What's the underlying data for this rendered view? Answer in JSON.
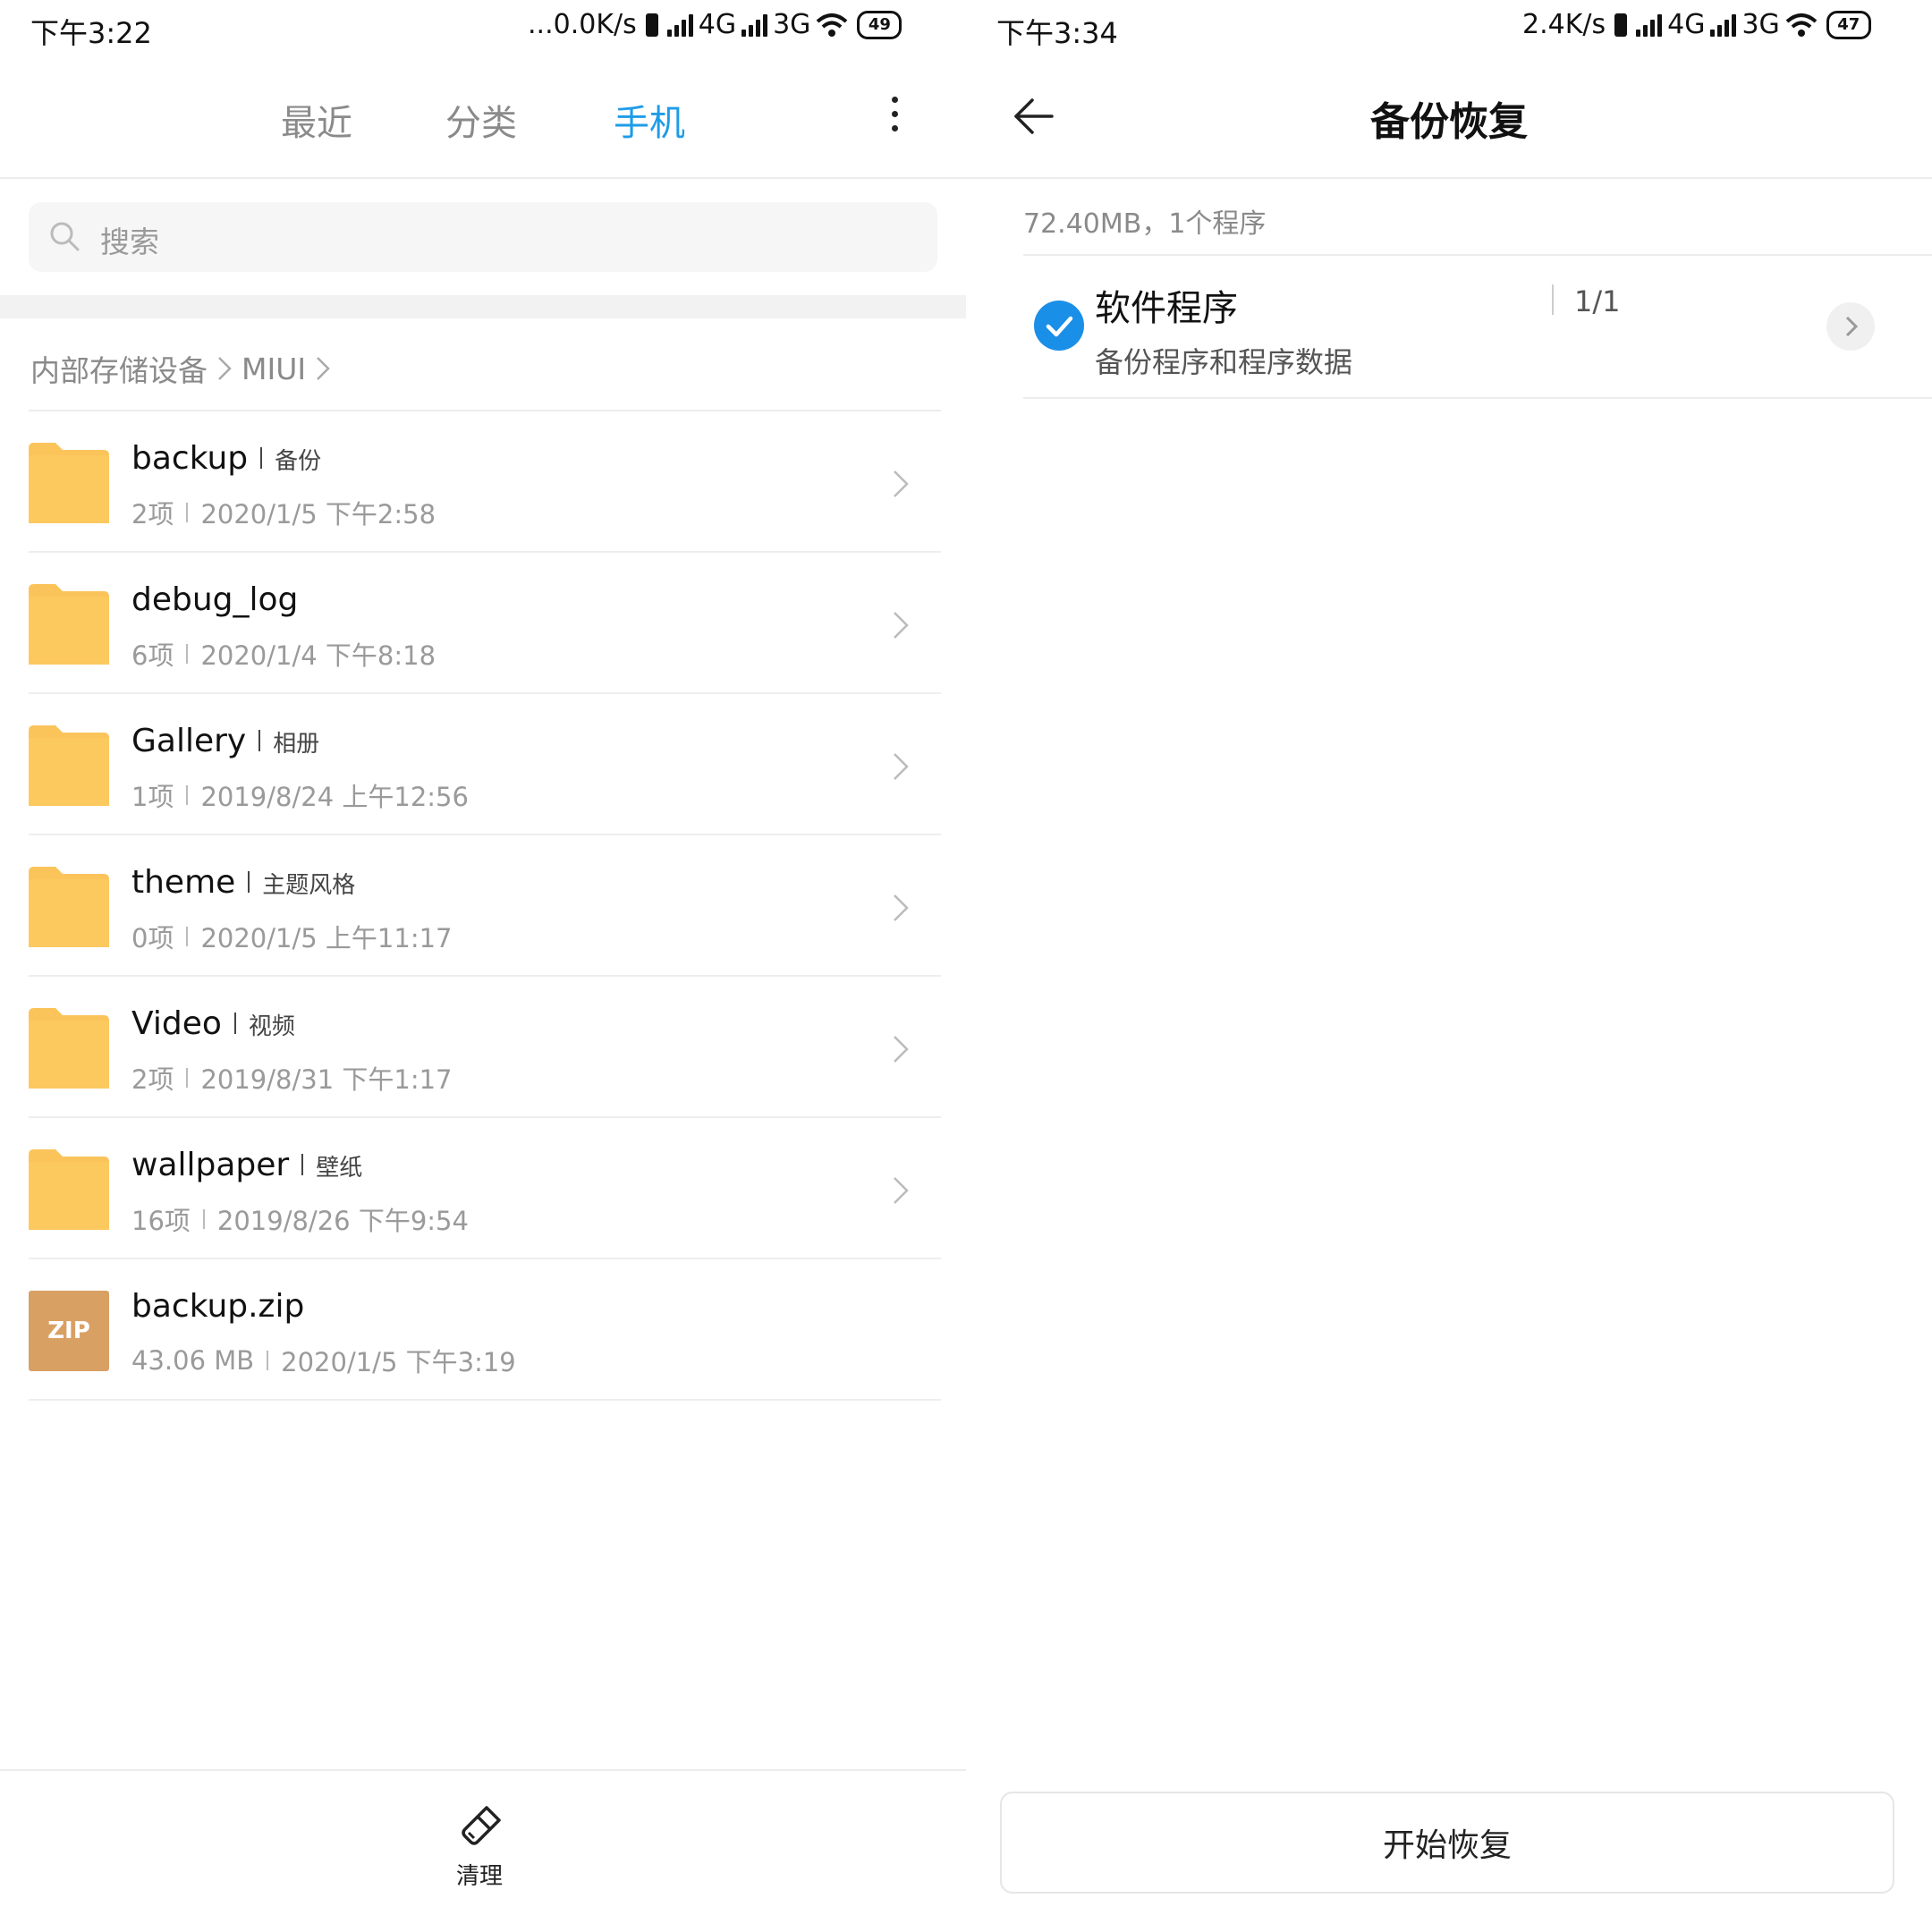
{
  "left": {
    "status_bar": {
      "time": "下午3:22",
      "speed": "...0.0K/s",
      "net1": "4G",
      "net2": "3G",
      "battery": "49"
    },
    "tabs": [
      {
        "label": "最近",
        "active": false
      },
      {
        "label": "分类",
        "active": false
      },
      {
        "label": "手机",
        "active": true
      }
    ],
    "search": {
      "placeholder": "搜索"
    },
    "breadcrumb": {
      "root": "内部存储设备",
      "current": "MIUI"
    },
    "items": [
      {
        "name": "backup",
        "alias": "备份",
        "count": "2项",
        "date": "2020/1/5 下午2:58",
        "type": "folder"
      },
      {
        "name": "debug_log",
        "alias": "",
        "count": "6项",
        "date": "2020/1/4 下午8:18",
        "type": "folder"
      },
      {
        "name": "Gallery",
        "alias": "相册",
        "count": "1项",
        "date": "2019/8/24 上午12:56",
        "type": "folder"
      },
      {
        "name": "theme",
        "alias": "主题风格",
        "count": "0项",
        "date": "2020/1/5 上午11:17",
        "type": "folder"
      },
      {
        "name": "Video",
        "alias": "视频",
        "count": "2项",
        "date": "2019/8/31 下午1:17",
        "type": "folder"
      },
      {
        "name": "wallpaper",
        "alias": "壁纸",
        "count": "16项",
        "date": "2019/8/26 下午9:54",
        "type": "folder"
      },
      {
        "name": "backup.zip",
        "alias": "",
        "count": "43.06 MB",
        "date": "2020/1/5 下午3:19",
        "type": "zip",
        "icon_text": "ZIP"
      }
    ],
    "bottom": {
      "clean_label": "清理"
    }
  },
  "right": {
    "status_bar": {
      "time": "下午3:34",
      "speed": "2.4K/s",
      "net1": "4G",
      "net2": "3G",
      "battery": "47"
    },
    "title": "备份恢复",
    "summary": "72.40MB，1个程序",
    "item": {
      "title": "软件程序",
      "subtitle": "备份程序和程序数据",
      "count": "1/1",
      "checked": true
    },
    "restore_button": "开始恢复"
  },
  "colors": {
    "accent": "#1e9ce8",
    "folder": "#fbc45a",
    "zip": "#d9a064",
    "check": "#1a8fe8"
  }
}
